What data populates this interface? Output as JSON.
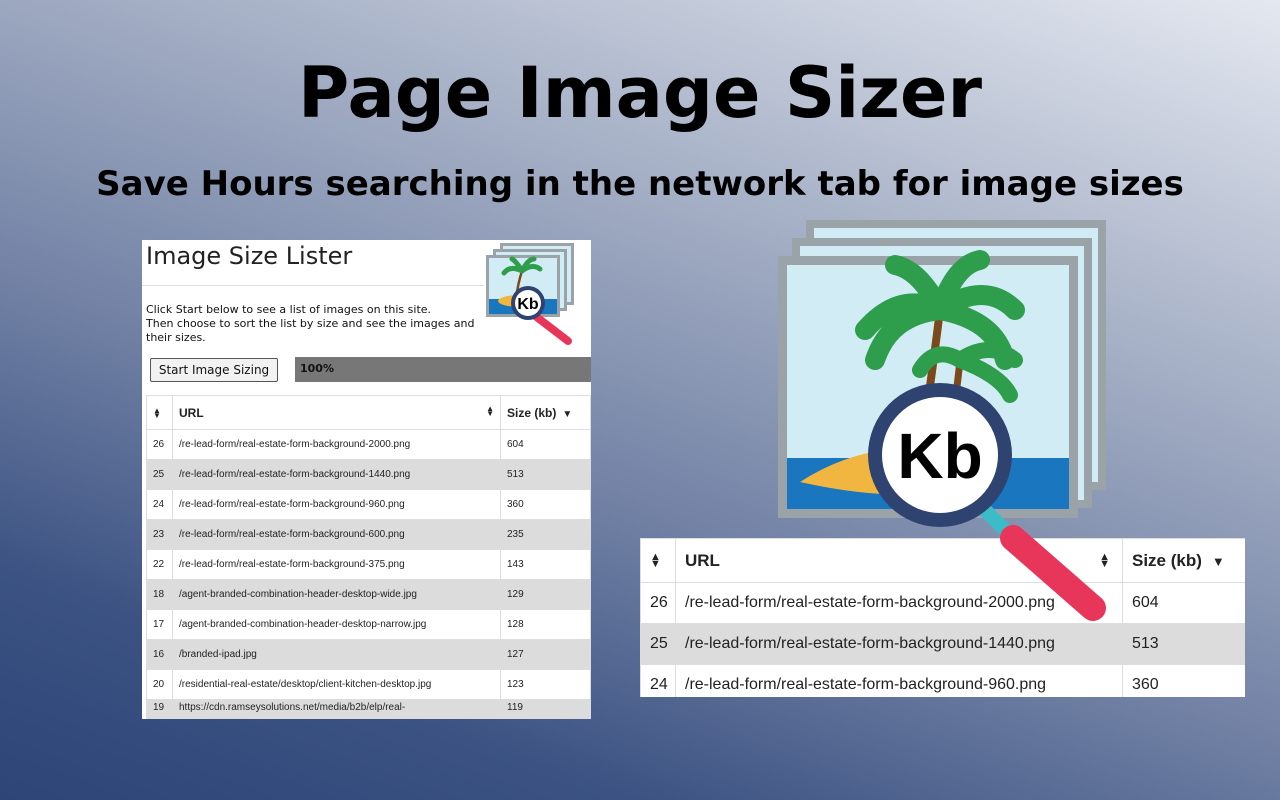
{
  "hero": {
    "title": "Page Image Sizer",
    "subtitle": "Save Hours searching in the network tab for image sizes"
  },
  "popup": {
    "title": "Image Size Lister",
    "description": [
      "Click Start below to see a list of images on this site.",
      "Then choose to sort the list by size and see the images and",
      "their sizes."
    ],
    "start_button": "Start Image Sizing",
    "progress_label": "100%",
    "progress_fraction": 1.0,
    "logo_text": "Kb",
    "columns": {
      "index": "",
      "url": "URL",
      "size": "Size (kb)"
    },
    "rows": [
      {
        "n": "26",
        "url": "/re-lead-form/real-estate-form-background-2000.png",
        "size": "604"
      },
      {
        "n": "25",
        "url": "/re-lead-form/real-estate-form-background-1440.png",
        "size": "513"
      },
      {
        "n": "24",
        "url": "/re-lead-form/real-estate-form-background-960.png",
        "size": "360"
      },
      {
        "n": "23",
        "url": "/re-lead-form/real-estate-form-background-600.png",
        "size": "235"
      },
      {
        "n": "22",
        "url": "/re-lead-form/real-estate-form-background-375.png",
        "size": "143"
      },
      {
        "n": "18",
        "url": "/agent-branded-combination-header-desktop-wide.jpg",
        "size": "129"
      },
      {
        "n": "17",
        "url": "/agent-branded-combination-header-desktop-narrow.jpg",
        "size": "128"
      },
      {
        "n": "16",
        "url": "/branded-ipad.jpg",
        "size": "127"
      },
      {
        "n": "20",
        "url": "/residential-real-estate/desktop/client-kitchen-desktop.jpg",
        "size": "123"
      },
      {
        "n": "19",
        "url": "https://cdn.ramseysolutions.net/media/b2b/elp/real-",
        "size": "119"
      }
    ]
  },
  "logo": {
    "text": "Kb"
  },
  "zoom_table": {
    "columns": {
      "index": "",
      "url": "URL",
      "size": "Size (kb)"
    },
    "rows": [
      {
        "n": "26",
        "url": "/re-lead-form/real-estate-form-background-2000.png",
        "size": "604"
      },
      {
        "n": "25",
        "url": "/re-lead-form/real-estate-form-background-1440.png",
        "size": "513"
      },
      {
        "n": "24",
        "url": "/re-lead-form/real-estate-form-background-960.png",
        "size": "360"
      }
    ]
  },
  "colors": {
    "frame": "#9aa4a8",
    "sky": "#d2ecf6",
    "sea": "#1976bf",
    "sand": "#f0b640",
    "magnifier_ring": "#2f4370",
    "magnifier_handle": "#e8365a",
    "palm_leaf": "#2e9e4d",
    "progress_fill": "#777777"
  }
}
